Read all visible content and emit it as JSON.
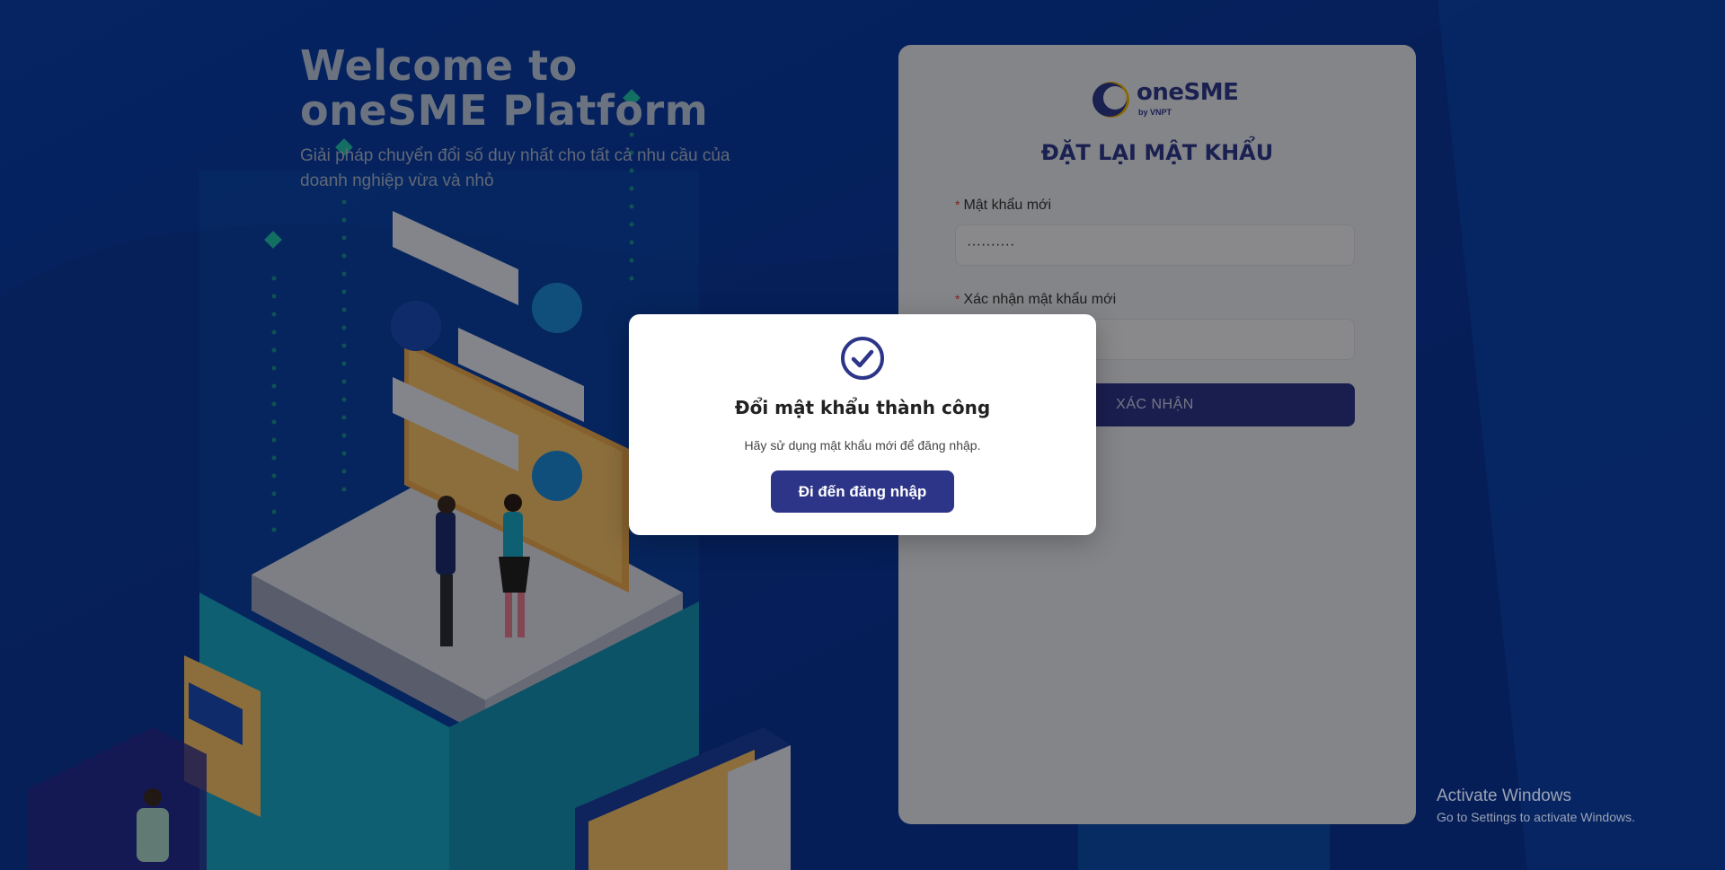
{
  "hero": {
    "title_line1": "Welcome to",
    "title_line2": "oneSME Platform",
    "subtitle": "Giải pháp chuyển đổi số duy nhất cho tất cả nhu cầu của doanh nghiệp vừa và nhỏ"
  },
  "logo": {
    "name": "oneSME",
    "byline": "by VNPT"
  },
  "form": {
    "title": "ĐẶT LẠI MẬT KHẨU",
    "new_password_label": "Mật khẩu mới",
    "new_password_value": "··········",
    "confirm_password_label": "Xác nhận mật khẩu mới",
    "confirm_password_value": "",
    "required_mark": "*",
    "submit_label": "XÁC NHẬN"
  },
  "modal": {
    "icon": "check-circle-icon",
    "title": "Đổi mật khẩu thành công",
    "message": "Hãy sử dụng mật khẩu mới để đăng nhập.",
    "button_label": "Đi đến đăng nhập"
  },
  "watermark": {
    "title": "Activate Windows",
    "subtitle": "Go to Settings to activate Windows."
  },
  "colors": {
    "primary": "#2d3588",
    "background": "#0a3a9a",
    "accent": "#f0b000"
  }
}
